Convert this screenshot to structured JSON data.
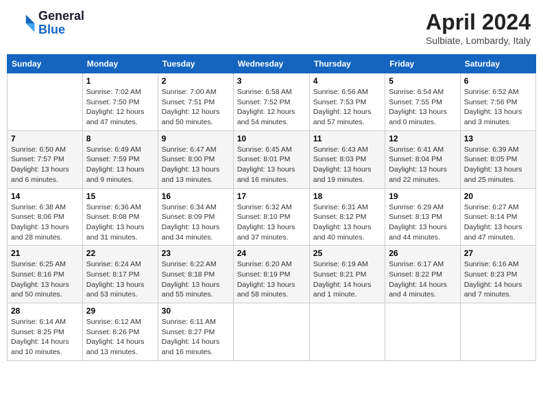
{
  "header": {
    "logo_line1": "General",
    "logo_line2": "Blue",
    "month_title": "April 2024",
    "location": "Sulbiate, Lombardy, Italy"
  },
  "columns": [
    "Sunday",
    "Monday",
    "Tuesday",
    "Wednesday",
    "Thursday",
    "Friday",
    "Saturday"
  ],
  "weeks": [
    [
      {
        "day": "",
        "sunrise": "",
        "sunset": "",
        "daylight": ""
      },
      {
        "day": "1",
        "sunrise": "Sunrise: 7:02 AM",
        "sunset": "Sunset: 7:50 PM",
        "daylight": "Daylight: 12 hours and 47 minutes."
      },
      {
        "day": "2",
        "sunrise": "Sunrise: 7:00 AM",
        "sunset": "Sunset: 7:51 PM",
        "daylight": "Daylight: 12 hours and 50 minutes."
      },
      {
        "day": "3",
        "sunrise": "Sunrise: 6:58 AM",
        "sunset": "Sunset: 7:52 PM",
        "daylight": "Daylight: 12 hours and 54 minutes."
      },
      {
        "day": "4",
        "sunrise": "Sunrise: 6:56 AM",
        "sunset": "Sunset: 7:53 PM",
        "daylight": "Daylight: 12 hours and 57 minutes."
      },
      {
        "day": "5",
        "sunrise": "Sunrise: 6:54 AM",
        "sunset": "Sunset: 7:55 PM",
        "daylight": "Daylight: 13 hours and 0 minutes."
      },
      {
        "day": "6",
        "sunrise": "Sunrise: 6:52 AM",
        "sunset": "Sunset: 7:56 PM",
        "daylight": "Daylight: 13 hours and 3 minutes."
      }
    ],
    [
      {
        "day": "7",
        "sunrise": "Sunrise: 6:50 AM",
        "sunset": "Sunset: 7:57 PM",
        "daylight": "Daylight: 13 hours and 6 minutes."
      },
      {
        "day": "8",
        "sunrise": "Sunrise: 6:49 AM",
        "sunset": "Sunset: 7:59 PM",
        "daylight": "Daylight: 13 hours and 9 minutes."
      },
      {
        "day": "9",
        "sunrise": "Sunrise: 6:47 AM",
        "sunset": "Sunset: 8:00 PM",
        "daylight": "Daylight: 13 hours and 13 minutes."
      },
      {
        "day": "10",
        "sunrise": "Sunrise: 6:45 AM",
        "sunset": "Sunset: 8:01 PM",
        "daylight": "Daylight: 13 hours and 16 minutes."
      },
      {
        "day": "11",
        "sunrise": "Sunrise: 6:43 AM",
        "sunset": "Sunset: 8:03 PM",
        "daylight": "Daylight: 13 hours and 19 minutes."
      },
      {
        "day": "12",
        "sunrise": "Sunrise: 6:41 AM",
        "sunset": "Sunset: 8:04 PM",
        "daylight": "Daylight: 13 hours and 22 minutes."
      },
      {
        "day": "13",
        "sunrise": "Sunrise: 6:39 AM",
        "sunset": "Sunset: 8:05 PM",
        "daylight": "Daylight: 13 hours and 25 minutes."
      }
    ],
    [
      {
        "day": "14",
        "sunrise": "Sunrise: 6:38 AM",
        "sunset": "Sunset: 8:06 PM",
        "daylight": "Daylight: 13 hours and 28 minutes."
      },
      {
        "day": "15",
        "sunrise": "Sunrise: 6:36 AM",
        "sunset": "Sunset: 8:08 PM",
        "daylight": "Daylight: 13 hours and 31 minutes."
      },
      {
        "day": "16",
        "sunrise": "Sunrise: 6:34 AM",
        "sunset": "Sunset: 8:09 PM",
        "daylight": "Daylight: 13 hours and 34 minutes."
      },
      {
        "day": "17",
        "sunrise": "Sunrise: 6:32 AM",
        "sunset": "Sunset: 8:10 PM",
        "daylight": "Daylight: 13 hours and 37 minutes."
      },
      {
        "day": "18",
        "sunrise": "Sunrise: 6:31 AM",
        "sunset": "Sunset: 8:12 PM",
        "daylight": "Daylight: 13 hours and 40 minutes."
      },
      {
        "day": "19",
        "sunrise": "Sunrise: 6:29 AM",
        "sunset": "Sunset: 8:13 PM",
        "daylight": "Daylight: 13 hours and 44 minutes."
      },
      {
        "day": "20",
        "sunrise": "Sunrise: 6:27 AM",
        "sunset": "Sunset: 8:14 PM",
        "daylight": "Daylight: 13 hours and 47 minutes."
      }
    ],
    [
      {
        "day": "21",
        "sunrise": "Sunrise: 6:25 AM",
        "sunset": "Sunset: 8:16 PM",
        "daylight": "Daylight: 13 hours and 50 minutes."
      },
      {
        "day": "22",
        "sunrise": "Sunrise: 6:24 AM",
        "sunset": "Sunset: 8:17 PM",
        "daylight": "Daylight: 13 hours and 53 minutes."
      },
      {
        "day": "23",
        "sunrise": "Sunrise: 6:22 AM",
        "sunset": "Sunset: 8:18 PM",
        "daylight": "Daylight: 13 hours and 55 minutes."
      },
      {
        "day": "24",
        "sunrise": "Sunrise: 6:20 AM",
        "sunset": "Sunset: 8:19 PM",
        "daylight": "Daylight: 13 hours and 58 minutes."
      },
      {
        "day": "25",
        "sunrise": "Sunrise: 6:19 AM",
        "sunset": "Sunset: 8:21 PM",
        "daylight": "Daylight: 14 hours and 1 minute."
      },
      {
        "day": "26",
        "sunrise": "Sunrise: 6:17 AM",
        "sunset": "Sunset: 8:22 PM",
        "daylight": "Daylight: 14 hours and 4 minutes."
      },
      {
        "day": "27",
        "sunrise": "Sunrise: 6:16 AM",
        "sunset": "Sunset: 8:23 PM",
        "daylight": "Daylight: 14 hours and 7 minutes."
      }
    ],
    [
      {
        "day": "28",
        "sunrise": "Sunrise: 6:14 AM",
        "sunset": "Sunset: 8:25 PM",
        "daylight": "Daylight: 14 hours and 10 minutes."
      },
      {
        "day": "29",
        "sunrise": "Sunrise: 6:12 AM",
        "sunset": "Sunset: 8:26 PM",
        "daylight": "Daylight: 14 hours and 13 minutes."
      },
      {
        "day": "30",
        "sunrise": "Sunrise: 6:11 AM",
        "sunset": "Sunset: 8:27 PM",
        "daylight": "Daylight: 14 hours and 16 minutes."
      },
      {
        "day": "",
        "sunrise": "",
        "sunset": "",
        "daylight": ""
      },
      {
        "day": "",
        "sunrise": "",
        "sunset": "",
        "daylight": ""
      },
      {
        "day": "",
        "sunrise": "",
        "sunset": "",
        "daylight": ""
      },
      {
        "day": "",
        "sunrise": "",
        "sunset": "",
        "daylight": ""
      }
    ]
  ]
}
